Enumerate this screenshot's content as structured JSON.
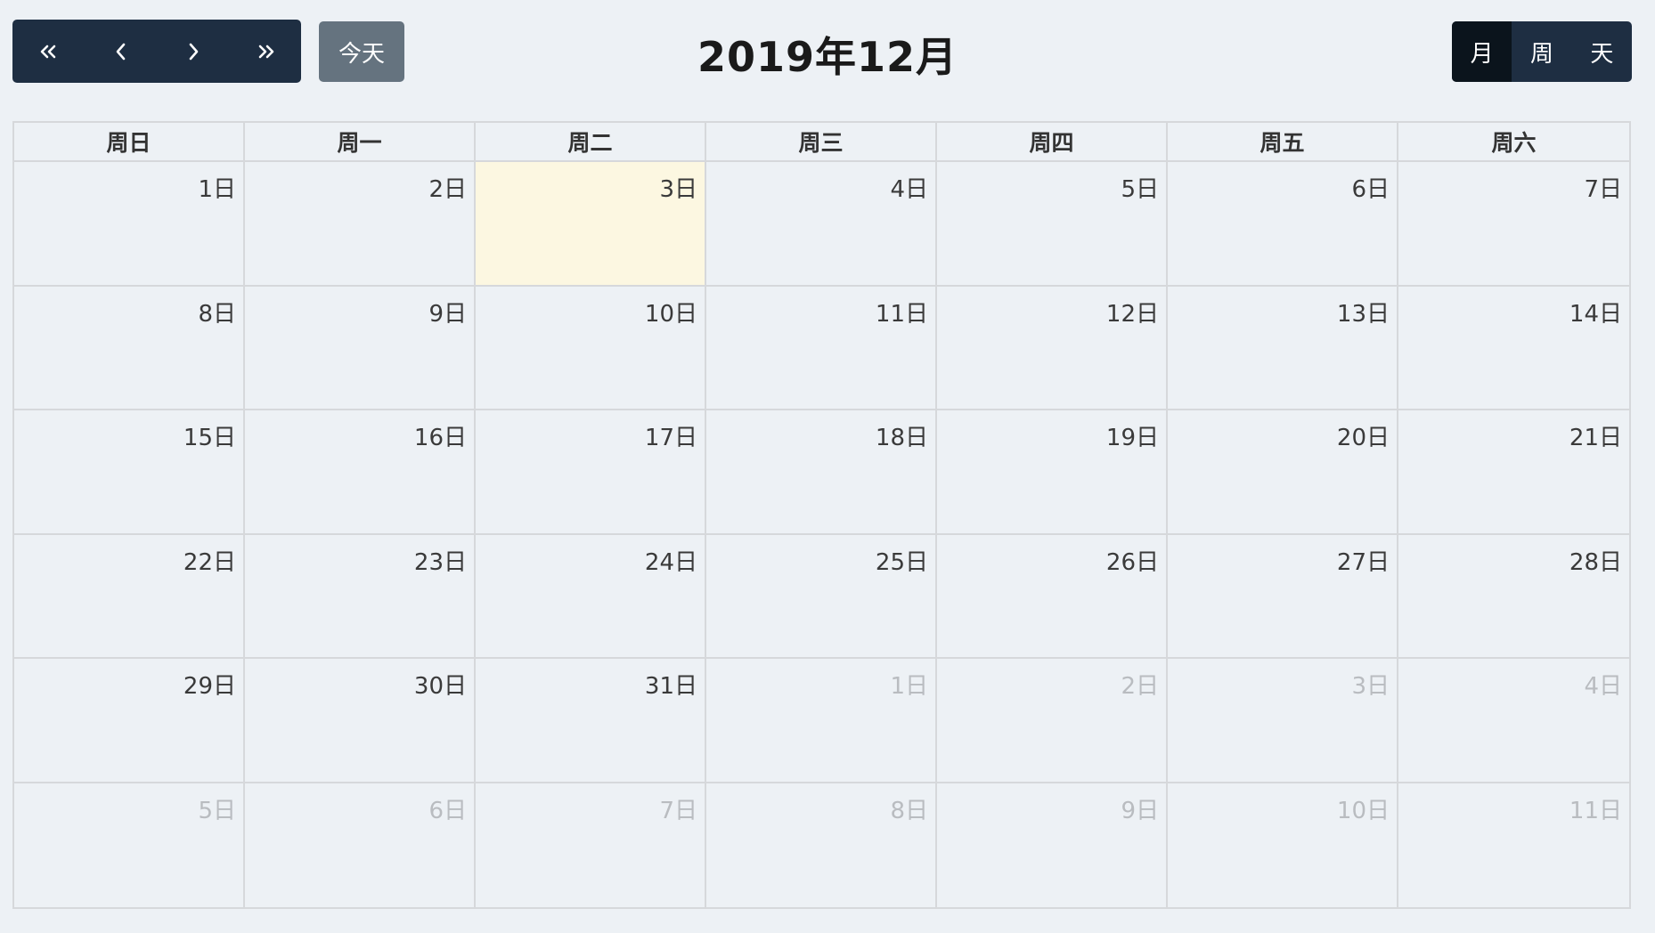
{
  "toolbar": {
    "nav": [
      {
        "name": "prev-year-button",
        "icon": "double-chevron-left-icon"
      },
      {
        "name": "prev-month-button",
        "icon": "chevron-left-icon"
      },
      {
        "name": "next-month-button",
        "icon": "chevron-right-icon"
      },
      {
        "name": "next-year-button",
        "icon": "double-chevron-right-icon"
      }
    ],
    "today_label": "今天",
    "title": "2019年12月",
    "views": [
      {
        "label": "月",
        "active": true
      },
      {
        "label": "周",
        "active": false
      },
      {
        "label": "天",
        "active": false
      }
    ]
  },
  "calendar": {
    "weekdays": [
      "周日",
      "周一",
      "周二",
      "周三",
      "周四",
      "周五",
      "周六"
    ],
    "weeks": [
      [
        {
          "label": "1日"
        },
        {
          "label": "2日"
        },
        {
          "label": "3日",
          "today": true
        },
        {
          "label": "4日"
        },
        {
          "label": "5日"
        },
        {
          "label": "6日"
        },
        {
          "label": "7日"
        }
      ],
      [
        {
          "label": "8日"
        },
        {
          "label": "9日"
        },
        {
          "label": "10日"
        },
        {
          "label": "11日"
        },
        {
          "label": "12日"
        },
        {
          "label": "13日"
        },
        {
          "label": "14日"
        }
      ],
      [
        {
          "label": "15日"
        },
        {
          "label": "16日"
        },
        {
          "label": "17日"
        },
        {
          "label": "18日"
        },
        {
          "label": "19日"
        },
        {
          "label": "20日"
        },
        {
          "label": "21日"
        }
      ],
      [
        {
          "label": "22日"
        },
        {
          "label": "23日"
        },
        {
          "label": "24日"
        },
        {
          "label": "25日"
        },
        {
          "label": "26日"
        },
        {
          "label": "27日"
        },
        {
          "label": "28日"
        }
      ],
      [
        {
          "label": "29日"
        },
        {
          "label": "30日"
        },
        {
          "label": "31日"
        },
        {
          "label": "1日",
          "other": true
        },
        {
          "label": "2日",
          "other": true
        },
        {
          "label": "3日",
          "other": true
        },
        {
          "label": "4日",
          "other": true
        }
      ],
      [
        {
          "label": "5日",
          "other": true
        },
        {
          "label": "6日",
          "other": true
        },
        {
          "label": "7日",
          "other": true
        },
        {
          "label": "8日",
          "other": true
        },
        {
          "label": "9日",
          "other": true
        },
        {
          "label": "10日",
          "other": true
        },
        {
          "label": "11日",
          "other": true
        }
      ]
    ]
  },
  "colors": {
    "background": "#edf1f5",
    "button_dark": "#1e2e42",
    "button_active": "#0b141c",
    "today_button": "#65737f",
    "today_cell": "#fcf7e1",
    "grid_border": "#d6d8db",
    "other_month_text": "#b9bcc0"
  }
}
